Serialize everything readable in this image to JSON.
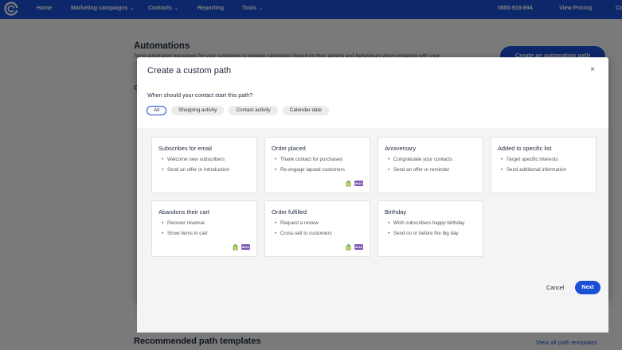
{
  "nav": {
    "items": [
      "Home",
      "Marketing campaigns",
      "Contacts",
      "Reporting",
      "Tools"
    ],
    "phone": "0800-918-694",
    "view_pricing": "View Pricing",
    "cut": "Co"
  },
  "background": {
    "title": "Automations",
    "description": "Send automated messages for your customers to engage campaigns based on their actions and behaviours when engaging with your",
    "tab": "C",
    "create_button": "Create an automation path",
    "reco_title": "Recommended path templates",
    "reco_link": "View all path templates"
  },
  "modal": {
    "title": "Create a custom path",
    "close": "×",
    "question": "When should your contact start this path?",
    "filters": [
      "All",
      "Shopping activity",
      "Contact activity",
      "Calendar date"
    ],
    "active_filter": "All",
    "cards": [
      {
        "title": "Subscribes for email",
        "bullets": [
          "Welcome new subscribers",
          "Send an offer or introduction"
        ],
        "integrations": false
      },
      {
        "title": "Order placed",
        "bullets": [
          "Thank contact for purchases",
          "Re-engage lapsed customers"
        ],
        "integrations": true
      },
      {
        "title": "Anniversary",
        "bullets": [
          "Congratulate your contacts",
          "Send an offer or reminder"
        ],
        "integrations": false
      },
      {
        "title": "Added to specific list",
        "bullets": [
          "Target specific interests",
          "Send additional information"
        ],
        "integrations": false
      },
      {
        "title": "Abandons their cart",
        "bullets": [
          "Recover revenue",
          "Show items in cart"
        ],
        "integrations": true
      },
      {
        "title": "Order fulfilled",
        "bullets": [
          "Request a review",
          "Cross-sell to customers"
        ],
        "integrations": true
      },
      {
        "title": "Birthday",
        "bullets": [
          "Wish subscribers happy birthday",
          "Send on or before the big day"
        ],
        "integrations": false
      }
    ],
    "woo_label": "WOO",
    "cancel": "Cancel",
    "next": "Next"
  },
  "colors": {
    "brand_blue": "#1b4fd6",
    "shopify_green": "#95bf47",
    "woo_purple": "#7f54b3"
  }
}
